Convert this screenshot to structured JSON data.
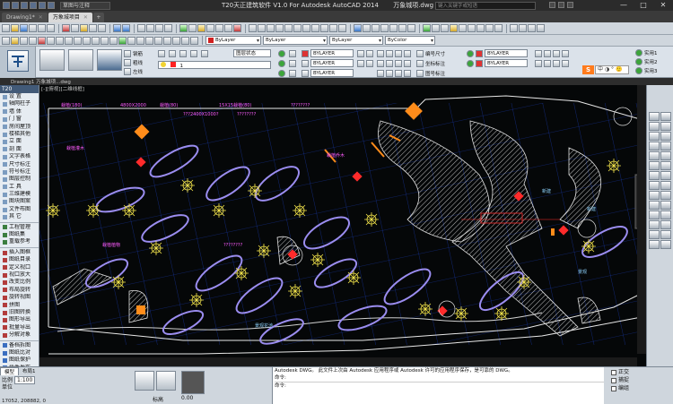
{
  "titlebar": {
    "app_title": "T20天正建筑软件 V1.0 For Autodesk AutoCAD 2014",
    "file_name": "万象城项.dwg",
    "workspace": "草图与注释",
    "search_placeholder": "键入关键字或短语",
    "controls": {
      "minimize": "—",
      "maximize": "□",
      "close": "✕"
    }
  },
  "doc_tabs": {
    "tabs": [
      {
        "label": "Drawing1*"
      },
      {
        "label": "万象城项目"
      }
    ],
    "plus": "+"
  },
  "toolbar2": {
    "layer": "ByLayer",
    "linetype": "ByLayer",
    "lineweight": "ByLayer",
    "plotstyle": "ByColor",
    "colors": {
      "layer_swatch": "#d02020"
    }
  },
  "ribbon": {
    "panel_labels": [
      "钢筋",
      "粗线",
      "左线"
    ],
    "layer_combo": "图层状态",
    "layer_props": [
      "BYLAYER",
      "BYLAYER",
      "BYLAYER"
    ],
    "layer_props_b": [
      "BYLAYER",
      "BYLAYER"
    ],
    "right_labels": [
      "编号尺寸",
      "坐标标注",
      "图号标注"
    ],
    "far_right": [
      "实用1",
      "实用2",
      "实用3"
    ],
    "layer_current": "1"
  },
  "draw_header": {
    "label": "Drawing1  万象城项...dwg"
  },
  "viewport_label": "[-][俯视][二维线框]",
  "left_palette": {
    "header": "T20",
    "items": [
      "设 置",
      "轴网柱子",
      "墙 体",
      "门 窗",
      "房间屋顶",
      "楼梯其他",
      "立 面",
      "剖 面",
      "文字表格",
      "尺寸标注",
      "符号标注",
      "图层控制",
      "工 具",
      "三维建模",
      "图块图案",
      "文件布图",
      "其 它"
    ],
    "items2": [
      "工程管理",
      "图纸集",
      "重载参考"
    ],
    "items3": [
      "插入图框",
      "图纸目录",
      "定义视口",
      "视口放大",
      "改变比例",
      "布局旋转",
      "旋转视图",
      "拼图",
      "旧图转换",
      "图形导出",
      "批量导出",
      "分解对象"
    ],
    "items4": [
      "备档拆图",
      "图纸比对",
      "图纸保护",
      "插件发布"
    ]
  },
  "bottom": {
    "tabs": [
      "模型",
      "布局1"
    ],
    "prop": {
      "scale_label": "比例",
      "scale": "1:100",
      "unit_label": "单位",
      "coord": "17052, 208882, 0"
    },
    "mid_value": "0.00",
    "mid_label": "标高",
    "cmd_lines": [
      "Autodesk DWG。  此文件上次由 Autodesk 应用程序或 Autodesk 许可的应用程序保存，是可靠的 DWG。",
      "命令:",
      "命令:"
    ],
    "status": [
      "正交",
      "捕捉",
      "编组"
    ]
  }
}
